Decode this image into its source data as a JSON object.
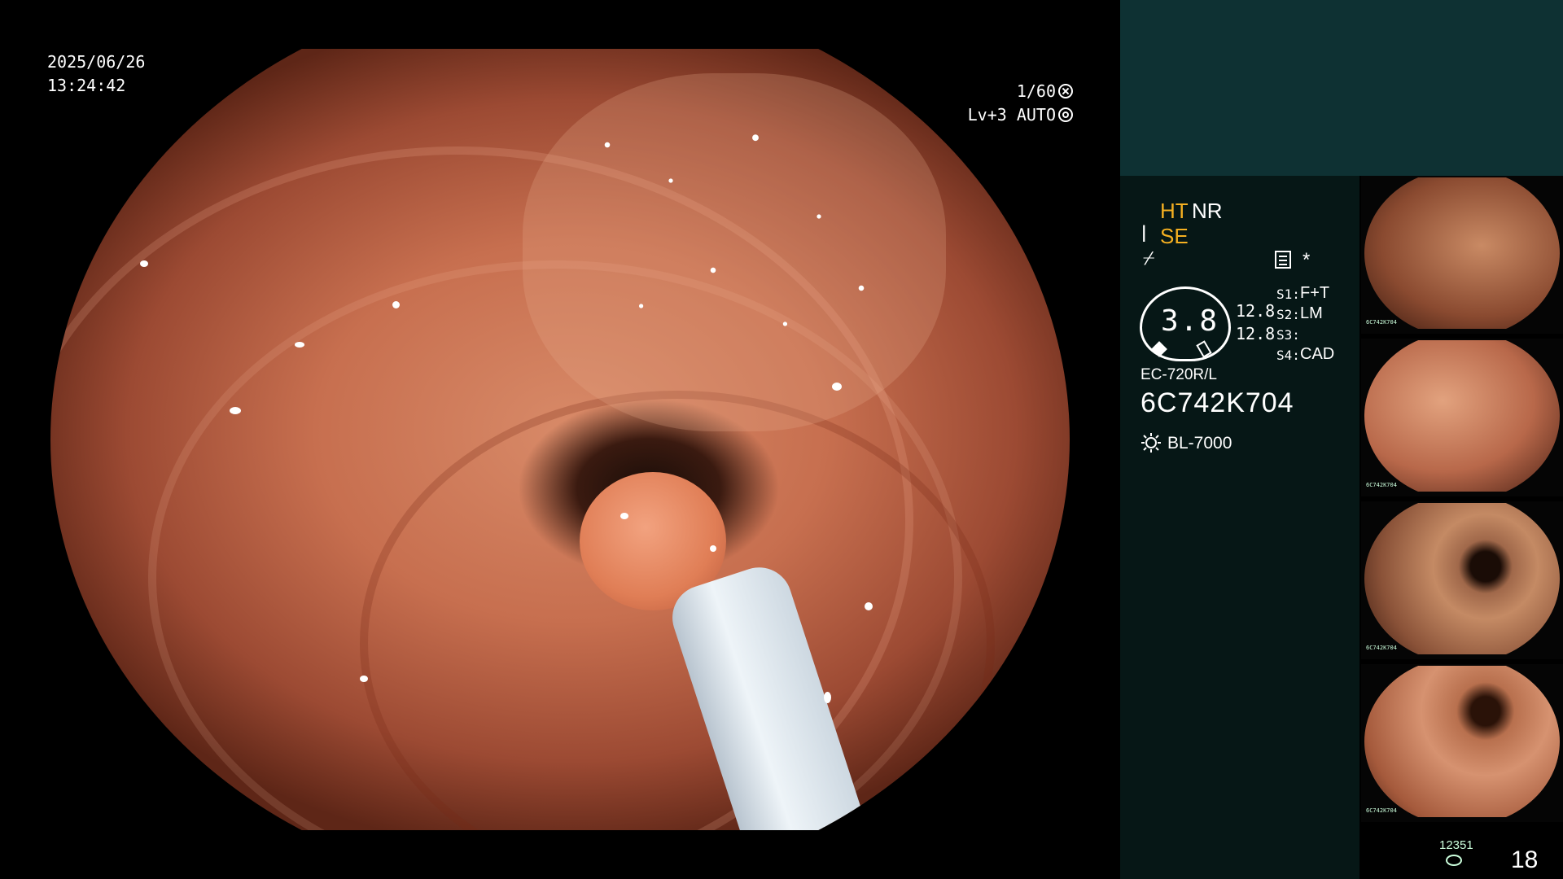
{
  "osd": {
    "date": "2025/06/26",
    "time": "13:24:42",
    "shutter": "1/60",
    "level": "Lv+3 AUTO"
  },
  "panel": {
    "ht": "HT",
    "nr": "NR",
    "se": "SE",
    "se_icon": "ꟾ",
    "f_icon": "⌿",
    "star": "*",
    "dial_value": "3.8",
    "value_1": "12.8",
    "value_2": "12.8",
    "switches": [
      {
        "label": "S1:",
        "value": "F+T"
      },
      {
        "label": "S2:",
        "value": "LM"
      },
      {
        "label": "S3:",
        "value": ""
      },
      {
        "label": "S4:",
        "value": "CAD"
      }
    ],
    "scope_model": "EC-720R/L",
    "scope_serial": "6C742K704",
    "lamp": "BL-7000",
    "accent_color": "#f5b021"
  },
  "thumbnails": [
    {
      "label": "6C742K704"
    },
    {
      "label": "6C742K704"
    },
    {
      "label": "6C742K704"
    },
    {
      "label": "6C742K704"
    }
  ],
  "footer": {
    "storage_count": "12351",
    "image_count": "18"
  },
  "icons": [
    "shutter-icon",
    "iris-icon",
    "structure-enhance-icon",
    "filter-icon",
    "notes-icon",
    "lamp-icon",
    "disk-icon"
  ]
}
